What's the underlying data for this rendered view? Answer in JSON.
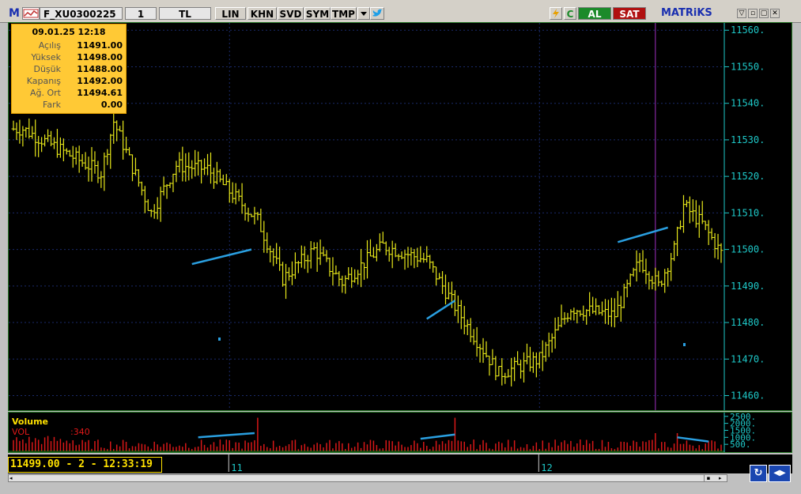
{
  "toolbar": {
    "logo": "M",
    "symbol": "F_XU0300225",
    "period": "1",
    "currency": "TL",
    "lin": "LIN",
    "khn": "KHN",
    "svd": "SVD",
    "sym": "SYM",
    "tmp": "TMP",
    "c_label": "C",
    "buy_label": "AL",
    "sell_label": "SAT",
    "brand": "MATRiKS"
  },
  "infobox": {
    "datetime": "09.01.25 12:18",
    "rows": [
      {
        "label": "Açılış",
        "value": "11491.00"
      },
      {
        "label": "Yüksek",
        "value": "11498.00"
      },
      {
        "label": "Düşük",
        "value": "11488.00"
      },
      {
        "label": "Kapanış",
        "value": "11492.00"
      },
      {
        "label": "Ağ. Ort",
        "value": "11494.61"
      },
      {
        "label": "Fark",
        "value": "0.00"
      }
    ]
  },
  "volume_panel": {
    "title": "Volume",
    "indicator": "VOL",
    "value": ":340",
    "ticks": [
      "2500.",
      "2000.",
      "1500.",
      "1000.",
      "500."
    ]
  },
  "cursor_readout": "11499.00 - 2 - 12:33:19",
  "colors": {
    "price_bars": "#e8e81a",
    "trendlines": "#2a9fe0",
    "axis_text": "#1ec8c8",
    "grid": "#1a2a6a",
    "volume_bars": "#d81818",
    "cursor_line": "#a030c0"
  },
  "chart_data": {
    "type": "ohlc",
    "y_ticks": [
      11460,
      11470,
      11480,
      11490,
      11500,
      11510,
      11520,
      11530,
      11540,
      11550,
      11560
    ],
    "y_tick_labels": [
      "11460.",
      "11470.",
      "11480.",
      "11490.",
      "11500.",
      "11510.",
      "11520.",
      "11530.",
      "11540.",
      "11550.",
      "11560."
    ],
    "ylim": [
      11456,
      11562
    ],
    "x_labels": [
      {
        "index": 69,
        "label": "11"
      },
      {
        "index": 168,
        "label": "12"
      }
    ],
    "num_bars": 227,
    "volume_ylim": [
      0,
      2600
    ],
    "segments": [
      {
        "from_bar": 3,
        "to_bar": 28,
        "from": 11533,
        "to": 11521
      },
      {
        "from_bar": 28,
        "to_bar": 32,
        "from": 11521,
        "to": 11535
      },
      {
        "from_bar": 32,
        "to_bar": 44,
        "from": 11535,
        "to": 11510
      },
      {
        "from_bar": 44,
        "to_bar": 52,
        "from": 11510,
        "to": 11523
      },
      {
        "from_bar": 52,
        "to_bar": 62,
        "from": 11523,
        "to": 11522
      },
      {
        "from_bar": 62,
        "to_bar": 78,
        "from": 11522,
        "to": 11508
      },
      {
        "from_bar": 78,
        "to_bar": 86,
        "from": 11508,
        "to": 11492
      },
      {
        "from_bar": 86,
        "to_bar": 96,
        "from": 11492,
        "to": 11500
      },
      {
        "from_bar": 96,
        "to_bar": 105,
        "from": 11500,
        "to": 11491
      },
      {
        "from_bar": 105,
        "to_bar": 118,
        "from": 11491,
        "to": 11501
      },
      {
        "from_bar": 118,
        "to_bar": 132,
        "from": 11501,
        "to": 11497
      },
      {
        "from_bar": 132,
        "to_bar": 142,
        "from": 11497,
        "to": 11483
      },
      {
        "from_bar": 142,
        "to_bar": 155,
        "from": 11483,
        "to": 11466
      },
      {
        "from_bar": 155,
        "to_bar": 168,
        "from": 11466,
        "to": 11470
      },
      {
        "from_bar": 168,
        "to_bar": 178,
        "from": 11470,
        "to": 11484
      },
      {
        "from_bar": 178,
        "to_bar": 192,
        "from": 11484,
        "to": 11482
      },
      {
        "from_bar": 192,
        "to_bar": 200,
        "from": 11482,
        "to": 11497
      },
      {
        "from_bar": 200,
        "to_bar": 206,
        "from": 11497,
        "to": 11490
      },
      {
        "from_bar": 206,
        "to_bar": 211,
        "from": 11490,
        "to": 11500
      },
      {
        "from_bar": 211,
        "to_bar": 214,
        "from": 11500,
        "to": 11512
      },
      {
        "from_bar": 214,
        "to_bar": 220,
        "from": 11512,
        "to": 11507
      },
      {
        "from_bar": 220,
        "to_bar": 226,
        "from": 11507,
        "to": 11499
      }
    ],
    "trendlines": [
      {
        "panel": "price",
        "x1": 57,
        "y1": 11496,
        "x2": 76,
        "y2": 11500
      },
      {
        "panel": "price",
        "x1": 132,
        "y1": 11481,
        "x2": 141,
        "y2": 11486
      },
      {
        "panel": "price",
        "x1": 193,
        "y1": 11502,
        "x2": 209,
        "y2": 11506
      },
      {
        "panel": "volume",
        "x1": 59,
        "y1": 1000,
        "x2": 77,
        "y2": 1300
      },
      {
        "panel": "volume",
        "x1": 130,
        "y1": 900,
        "x2": 141,
        "y2": 1200
      },
      {
        "panel": "volume",
        "x1": 212,
        "y1": 1000,
        "x2": 222,
        "y2": 700
      }
    ]
  }
}
